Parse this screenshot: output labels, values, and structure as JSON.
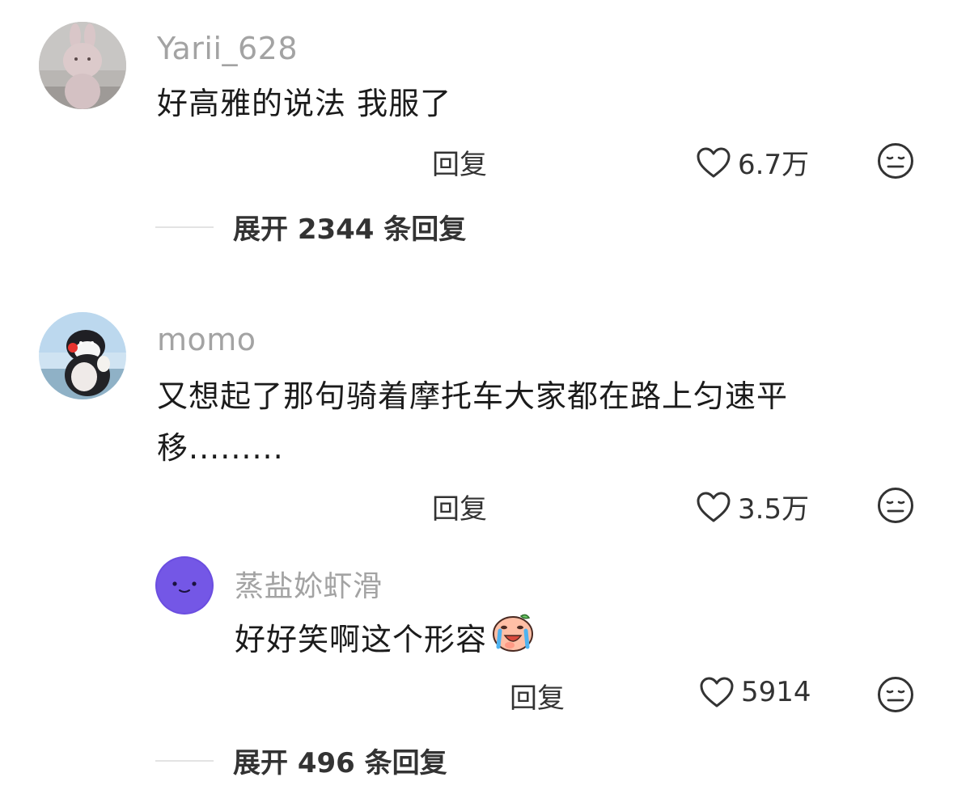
{
  "comments": [
    {
      "username": "Yarii_628",
      "text": "好高雅的说法 我服了",
      "reply_label": "回复",
      "like_count": "6.7万",
      "expand_label": "展开 2344 条回复"
    },
    {
      "username": "momo",
      "text_line1": "又想起了那句骑着摩托车大家都在路上匀速平",
      "text_line2": "移.........",
      "reply_label": "回复",
      "like_count": "3.5万",
      "replies": [
        {
          "username": "蒸盐㚷虾滑",
          "text": "好好笑啊这个形容",
          "emoji": "laughing-crying-peach-emoji",
          "reply_label": "回复",
          "like_count": "5914"
        }
      ],
      "expand_label": "展开 496 条回复"
    }
  ],
  "icons": {
    "like": "heart-outline-icon",
    "dislike": "neutral-face-icon"
  },
  "colors": {
    "username": "#a3a3a3",
    "text": "#1b1b1b",
    "action": "#333333",
    "divider": "#e3e3e3"
  }
}
